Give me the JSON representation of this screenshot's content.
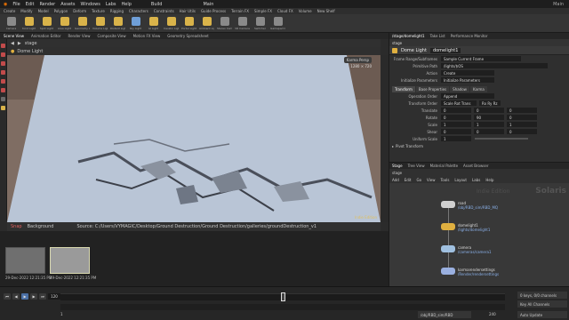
{
  "menu": [
    "File",
    "Edit",
    "Render",
    "Assets",
    "Windows",
    "Labs",
    "Help"
  ],
  "build_label": "Build",
  "main_label": "Main",
  "shelf_tabs": [
    "Create",
    "Modify",
    "Model",
    "Polygon",
    "Deform",
    "Texture",
    "Rigging",
    "Characters",
    "Constraints",
    "Hair Utils",
    "Guide Process",
    "Terrain FX",
    "Simple FX",
    "Cloud FX",
    "Volume",
    "New Shelf"
  ],
  "lights_tabs": [
    "Lights and Cameras",
    "Collisions",
    "Particles",
    "Grains",
    "Vellum",
    "Rigid Bodies",
    "Particle Fluids",
    "Viscous Fluids",
    "Oceans",
    "Pyro FX",
    "FEM",
    "Wires",
    "Crowds",
    "Drive Simulation"
  ],
  "tools": [
    {
      "label": "Camera",
      "color": "#8a8a8a"
    },
    {
      "label": "Point Light",
      "color": "#d9b34a"
    },
    {
      "label": "Spot Light",
      "color": "#d9b34a"
    },
    {
      "label": "Area Light",
      "color": "#d9b34a"
    },
    {
      "label": "Geometry Light",
      "color": "#d9b34a"
    },
    {
      "label": "Volume Light",
      "color": "#d9b34a"
    },
    {
      "label": "Distant Light",
      "color": "#d9b34a"
    },
    {
      "label": "Sky Light",
      "color": "#6f9fd8"
    },
    {
      "label": "GI Light",
      "color": "#d9b34a"
    },
    {
      "label": "Caustic Light",
      "color": "#d9b34a"
    },
    {
      "label": "Portal Light",
      "color": "#d9b34a"
    },
    {
      "label": "Ambient Light",
      "color": "#d9b34a"
    },
    {
      "label": "Stereo Camera",
      "color": "#8a8a8a"
    },
    {
      "label": "VR Camera",
      "color": "#8a8a8a"
    },
    {
      "label": "Switcher",
      "color": "#8a8a8a"
    },
    {
      "label": "Gamepad Camera",
      "color": "#8a8a8a"
    }
  ],
  "pane_tabs": [
    "Scene View",
    "Animation Editor",
    "Render View",
    "Composite View",
    "Motion FX View",
    "Geometry Spreadsheet"
  ],
  "viewport": {
    "path": "stage",
    "title": "Dome Light",
    "camera_menu": "Karma Persp",
    "res_line1": "1280 × 720",
    "label": "Indie Edition",
    "floor_color": "#b9c5d6",
    "bg_color": "#7f6d63"
  },
  "flipbook": {
    "header": "Snap",
    "background": "Background",
    "source": "Source: C:/Users/VYMAGIC/Desktop/Ground Destruction/Ground Destruction/galleries/groundDestruction_v10.stage/render/",
    "thumbs": [
      "29-Dec-2022 12:21:35 PM",
      "29-Dec-2022 12:21:35 PM"
    ]
  },
  "timeline": {
    "frame": "120",
    "start": "1",
    "end_a": "240",
    "end_b": "240",
    "keys": "0 keys, 0/0 channels",
    "keyall": "Key All Channels",
    "auto_update": "Auto Update",
    "renderer": "/obj/RBD_sim/RBD"
  },
  "params": {
    "tabs": [
      "/stage/domelight1",
      "Take List",
      "Performance Monitor"
    ],
    "path": "stage",
    "node_type": "Dome Light",
    "node_name": "domelight1",
    "frame_range_label": "Frame Range/Subframes",
    "frame_range_value": "Sample Current Frame",
    "primitive_path_label": "Primitive Path",
    "primitive_path_value": "/lights/$OS",
    "action_label": "Action",
    "action_value": "Create",
    "init_label": "Initialize Parameters",
    "init_value": "Initialize Parameters",
    "param_tabs": [
      "Transform",
      "Base Properties",
      "Shadow",
      "Karma"
    ],
    "operation_order_label": "Operation Order",
    "operation_order_value": "Append",
    "transform_order_label": "Transform Order",
    "transform_order_value": "Scale Rot Trans",
    "rot_order": "Rx Ry Rz",
    "translate_label": "Translate",
    "translate": [
      "0",
      "0",
      "0"
    ],
    "rotate_label": "Rotate",
    "rotate": [
      "0",
      "90",
      "0"
    ],
    "scale_label": "Scale",
    "scale": [
      "1",
      "1",
      "1"
    ],
    "shear_label": "Shear",
    "shear": [
      "0",
      "0",
      "0"
    ],
    "uniform_scale_label": "Uniform Scale",
    "uniform_scale": "1",
    "pivot_label": "Pivot Transform"
  },
  "network": {
    "tabs": [
      "Stage",
      "Tree View",
      "Material Palette",
      "Asset Browser"
    ],
    "path": "stage",
    "menu": [
      "Add",
      "Edit",
      "Go",
      "View",
      "Tools",
      "Layout",
      "Labs",
      "Help"
    ],
    "context": "Solaris",
    "edition": "Indie Edition",
    "nodes": [
      {
        "name": "road",
        "sub": "/obj/RBD_sim/RBD_MQ",
        "color": "#d0d0d0"
      },
      {
        "name": "domelight1",
        "sub": "/lights/domelight1",
        "color": "#e0b040"
      },
      {
        "name": "camera",
        "sub": "/cameras/camera1",
        "color": "#a0c0e0"
      },
      {
        "name": "karmarendersettings",
        "sub": "/Render/rendersettings",
        "color": "#9ab0e0"
      }
    ]
  }
}
